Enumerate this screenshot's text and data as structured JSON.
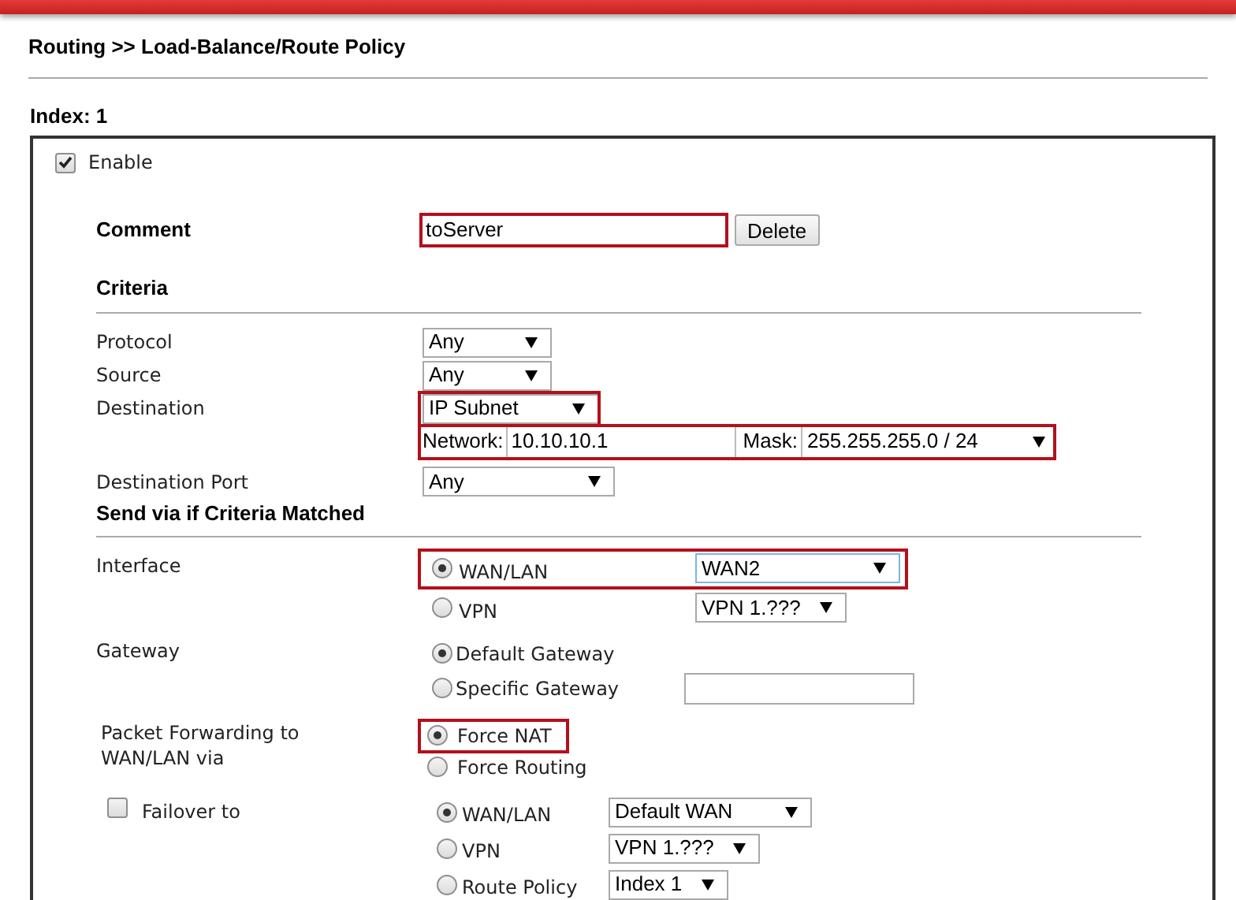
{
  "breadcrumb": "Routing >> Load-Balance/Route Policy",
  "index_label": "Index: 1",
  "enable": {
    "label": "Enable",
    "checked": true
  },
  "comment": {
    "label": "Comment",
    "value": "toServer",
    "highlighted": true,
    "button": "Delete"
  },
  "criteria": {
    "title": "Criteria",
    "rows": [
      {
        "label": "Protocol",
        "value": "Any",
        "highlighted": false
      },
      {
        "label": "Source",
        "value": "Any",
        "highlighted": false
      },
      {
        "label": "Destination",
        "value": "IP Subnet",
        "highlighted": true
      }
    ],
    "network": {
      "network_label": "Network:",
      "network_value": "10.10.10.1",
      "mask_label": "Mask:",
      "mask_value": "255.255.255.0 / 24",
      "highlighted": true
    },
    "port": {
      "label": "Destination Port",
      "value": "Any",
      "highlighted": false
    }
  },
  "send_via": {
    "title": "Send via if Criteria Matched",
    "interface": {
      "label": "Interface",
      "options": [
        {
          "label": "WAN/LAN",
          "selected": true,
          "value": "WAN2",
          "focused": true,
          "highlighted": true
        },
        {
          "label": "VPN",
          "selected": false,
          "value": "VPN 1.???",
          "focused": false,
          "highlighted": false
        }
      ]
    },
    "gateway": {
      "label": "Gateway",
      "options": [
        {
          "label": "Default Gateway",
          "selected": true,
          "kind": "plain"
        },
        {
          "label": "Specific Gateway",
          "selected": false,
          "kind": "input"
        }
      ]
    },
    "forwarding": {
      "label": "Packet Forwarding to WAN/LAN via",
      "options": [
        {
          "label": "Force NAT",
          "selected": true,
          "highlighted": true
        },
        {
          "label": "Force Routing",
          "selected": false,
          "highlighted": false
        }
      ]
    },
    "failover": {
      "label": "Failover to",
      "checked": false,
      "options": [
        {
          "label": "WAN/LAN",
          "selected": true,
          "value": "Default WAN"
        },
        {
          "label": "VPN",
          "selected": false,
          "value": "VPN 1.???"
        },
        {
          "label": "Route Policy",
          "selected": false,
          "value": "Index 1"
        }
      ]
    }
  }
}
